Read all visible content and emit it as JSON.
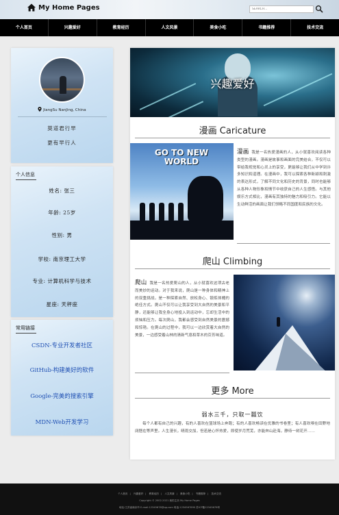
{
  "header": {
    "title": "My Home Pages",
    "search_placeholder": "SEARCH..."
  },
  "nav": [
    "个人首页",
    "兴趣爱好",
    "教育经历",
    "人文风景",
    "美食小吃",
    "书籍推荐",
    "技术交流"
  ],
  "profile": {
    "location": "JiangSu NanJing, China",
    "quote1": "莫道君行早",
    "quote2": "更有早行人"
  },
  "personal": {
    "title": "个人信息",
    "name": "姓名: 张三",
    "age": "年龄: 25岁",
    "gender": "性别: 男",
    "school": "学校: 南京理工大学",
    "major": "专业: 计算机科学与技术",
    "sign": "星座: 天秤座"
  },
  "links": {
    "title": "常用链接",
    "items": [
      "CSDN-专业开发者社区",
      "GitHub-构建美好的软件",
      "Google-完美的搜索引擎",
      "MDN-Web开发学习"
    ]
  },
  "banner": {
    "title": "兴趣爱好",
    "anime_image_text": "GO TO NEW WORLD"
  },
  "anime": {
    "heading": "漫画 Caricature",
    "lead": "漫画",
    "text": "我是一名热爱漫画的人，从小就喜欢阅读各种类型的漫画。漫画是故事和画面的完美结合，不仅可以带给我视觉和心灵上的享受，更能够让我们从中学到许多知识和道理。在漫画中，我可以探索各种新颖和刺激的表达形式，了解不同文化和历史的背景，同时也能够从各种人物形象和情节中收获自己的人生感悟。与其他娱乐方式相比，漫画有其独特的魅力和吸引力。它能以生动鲜活的画面让我们领略不同国度和民族的文化。"
  },
  "climb": {
    "heading": "爬山 Climbing",
    "lead": "爬山",
    "text": "我是一名热爱爬山的人，从小就喜欢这项古老而美妙的运动。对于我来说，爬山是一种身体和精神上的双重挑战，是一种探索自然、放松身心、锻炼体魄的绝佳方式。爬山不仅可以让我享受到大自然的美景和平静，还能够让我全身心地投入到运动中，忘却生活中的烦恼和压力。每次爬山，我都会感受到自然美景的震撼和惊艳。在爬山的过程中，我可以一边欣赏着大自然的美景，一边感受着山林的清新气息和草木的芬芳味道。"
  },
  "more": {
    "heading": "更多 More",
    "quote": "弱水三千，只取一瓢饮",
    "text": "每个人都有自己的兴趣，有的人喜欢在篮球场上奔跑；有的人喜欢畅读在优雅的书卷里；有人喜欢嗅在田野地阔惬在等声里。人生漫长，晴雨交加，但若是心怀热爱，即使岁月荒芜，亦能奔山赴海，静待一树花开……"
  },
  "footer": {
    "links": [
      "个人首页",
      "兴趣爱好",
      "教育经历",
      "人文风景",
      "美食小吃",
      "书籍推荐",
      "技术交流"
    ],
    "copyright": "Copyright © 2002-2021 我的主页 My Home Pages",
    "icp": "地址:江苏省南京市 E-mail:12345678@qq.com 电话:1234567890 苏ICP备12345678号"
  },
  "colors": {
    "nav_bg": "#000000",
    "link": "#1e4fb3",
    "footer_bg": "#111111"
  }
}
